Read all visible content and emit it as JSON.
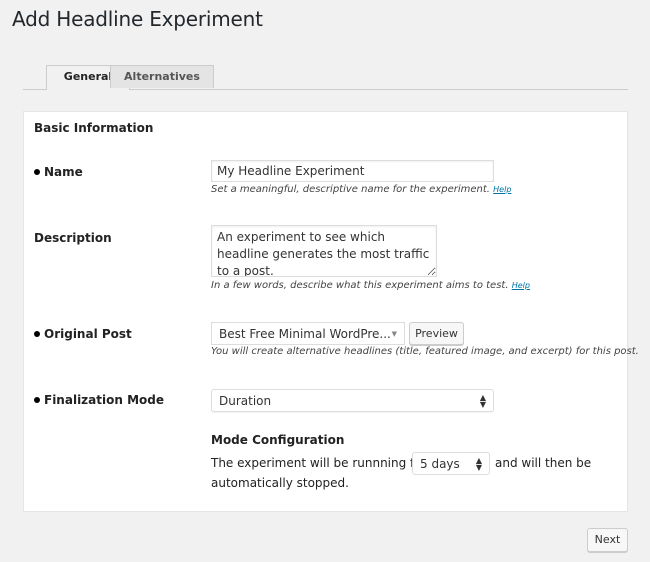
{
  "page": {
    "title": "Add Headline Experiment"
  },
  "tabs": [
    {
      "label": "General",
      "active": true
    },
    {
      "label": "Alternatives",
      "active": false
    }
  ],
  "panel": {
    "section_title": "Basic Information",
    "name": {
      "label": "Name",
      "required": true,
      "value": "My Headline Experiment",
      "hint": "Set a meaningful, descriptive name for the experiment.",
      "help_label": "Help"
    },
    "description": {
      "label": "Description",
      "required": false,
      "value": "An experiment to see which headline generates the most traffic to a post.",
      "hint": "In a few words, describe what this experiment aims to test.",
      "help_label": "Help"
    },
    "original_post": {
      "label": "Original Post",
      "required": true,
      "selected": "Best Free Minimal WordPre...",
      "preview_label": "Preview",
      "hint": "You will create alternative headlines (title, featured image, and excerpt) for this post."
    },
    "finalization_mode": {
      "label": "Finalization Mode",
      "required": true,
      "selected": "Duration"
    },
    "mode_configuration": {
      "title": "Mode Configuration",
      "text_before": "The experiment will be runnning for",
      "duration_selected": "5 days",
      "text_after": "and will then be",
      "text_line2": "automatically stopped."
    }
  },
  "footer": {
    "next_label": "Next"
  }
}
